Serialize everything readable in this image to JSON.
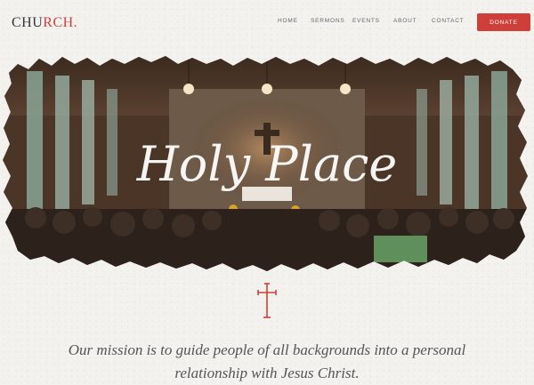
{
  "brand": {
    "logo_main": "CHU",
    "logo_accent": "RCH."
  },
  "nav": {
    "items": [
      "HOME",
      "SERMONS",
      "EVENTS",
      "ABOUT",
      "CONTACT"
    ],
    "donate_label": "DONATE"
  },
  "hero": {
    "title": "Holy Place",
    "image": "church-interior-wedding-photo"
  },
  "mission": {
    "icon": "cross-icon",
    "text": "Our mission is to guide people of all backgrounds into a personal relationship with Jesus Christ."
  },
  "colors": {
    "accent": "#cf3f3a",
    "text": "#555555",
    "background": "#f4f2ef"
  }
}
